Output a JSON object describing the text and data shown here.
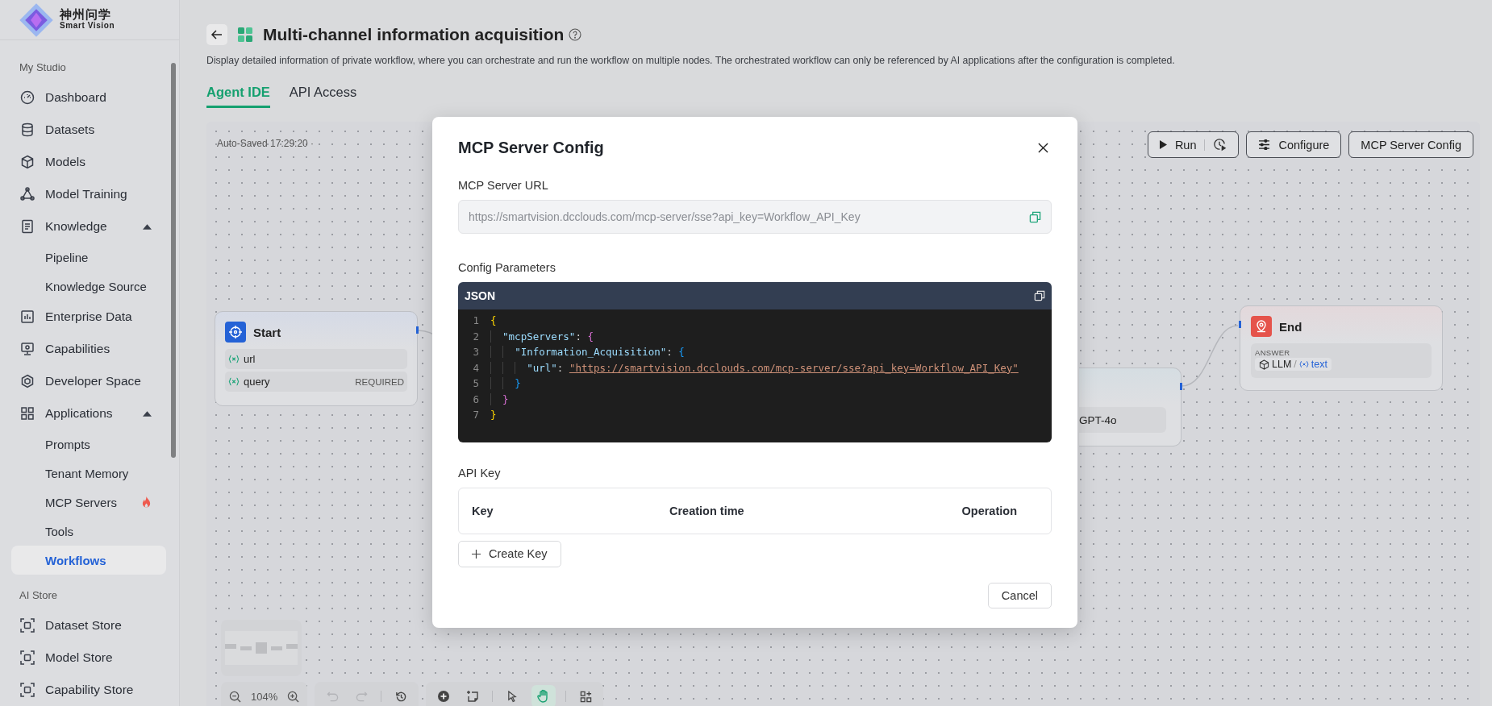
{
  "sidebar": {
    "logo": {
      "name": "神州问学",
      "tagline": "Smart Vision"
    },
    "sections": [
      {
        "title": "My Studio",
        "items": [
          {
            "label": "Dashboard",
            "selected": false
          },
          {
            "label": "Datasets",
            "selected": false
          },
          {
            "label": "Models",
            "selected": false
          },
          {
            "label": "Model Training",
            "selected": false
          },
          {
            "label": "Knowledge",
            "selected": false,
            "expanded": true,
            "children": [
              {
                "label": "Pipeline",
                "selected": false,
                "hot": false
              },
              {
                "label": "Knowledge Source",
                "selected": false,
                "hot": false
              }
            ]
          },
          {
            "label": "Enterprise Data",
            "selected": false
          },
          {
            "label": "Capabilities",
            "selected": false
          },
          {
            "label": "Developer Space",
            "selected": false
          },
          {
            "label": "Applications",
            "selected": false,
            "expanded": true,
            "children": [
              {
                "label": "Prompts",
                "selected": false,
                "hot": false
              },
              {
                "label": "Tenant Memory",
                "selected": false,
                "hot": false
              },
              {
                "label": "MCP Servers",
                "selected": false,
                "hot": true
              },
              {
                "label": "Tools",
                "selected": false,
                "hot": false
              },
              {
                "label": "Workflows",
                "selected": true,
                "hot": false
              }
            ]
          }
        ]
      },
      {
        "title": "AI Store",
        "items": [
          {
            "label": "Dataset Store",
            "selected": false
          },
          {
            "label": "Model Store",
            "selected": false
          },
          {
            "label": "Capability Store",
            "selected": false
          }
        ]
      }
    ]
  },
  "header": {
    "title": "Multi-channel information acquisition",
    "description": "Display detailed information of private workflow, where you can orchestrate and run the workflow on multiple nodes. The orchestrated workflow can only be referenced by AI applications after the configuration is completed.",
    "tabs": [
      {
        "label": "Agent IDE",
        "selected": true
      },
      {
        "label": "API Access",
        "selected": false
      }
    ]
  },
  "canvas": {
    "auto_saved": "Auto-Saved 17:29:20 ·",
    "toolbar": [
      {
        "kind": "run",
        "label": "Run"
      },
      {
        "kind": "configure",
        "label": "Configure"
      },
      {
        "kind": "plain",
        "label": "MCP Server Config"
      }
    ],
    "start_node": {
      "title": "Start",
      "variables": [
        {
          "name": "url"
        },
        {
          "name": "query",
          "tag": "REQUIRED"
        }
      ]
    },
    "llm_node": {
      "model": "GPT-4o"
    },
    "end_node": {
      "title": "End",
      "answer_label": "ANSWER",
      "source": "LLM",
      "separator": "/",
      "variable": "text"
    },
    "zoom": "104%",
    "history_tools": [
      {
        "kind": "undo",
        "disabled": true
      },
      {
        "kind": "redo",
        "disabled": true
      },
      {
        "kind": "history",
        "disabled": false
      }
    ],
    "edit_tools": [
      {
        "kind": "add",
        "selected": false
      },
      {
        "kind": "note",
        "selected": false
      },
      {
        "kind": "pointer",
        "selected": false
      },
      {
        "kind": "hand",
        "selected": true
      },
      {
        "kind": "layout",
        "selected": false
      }
    ]
  },
  "dialog": {
    "title": "MCP Server Config",
    "url_label": "MCP Server URL",
    "url": "https://smartvision.dcclouds.com/mcp-server/sse?api_key=Workflow_API_Key",
    "config_label": "Config Parameters",
    "code_language": "JSON",
    "code_lines": [
      {
        "number": "1",
        "text": "{"
      },
      {
        "number": "2",
        "text": "  \"mcpServers\": {"
      },
      {
        "number": "3",
        "text": "    \"Information_Acquisition\": {"
      },
      {
        "number": "4",
        "text": "      \"url\": \"https://smartvision.dcclouds.com/mcp-server/sse?api_key=Workflow_API_Key\""
      },
      {
        "number": "5",
        "text": "    }"
      },
      {
        "number": "6",
        "text": "  }"
      },
      {
        "number": "7",
        "text": "}"
      }
    ],
    "api_key_label": "API Key",
    "table_columns": [
      "Key",
      "Creation time",
      "Operation"
    ],
    "create_button": "Create Key",
    "cancel_button": "Cancel"
  }
}
